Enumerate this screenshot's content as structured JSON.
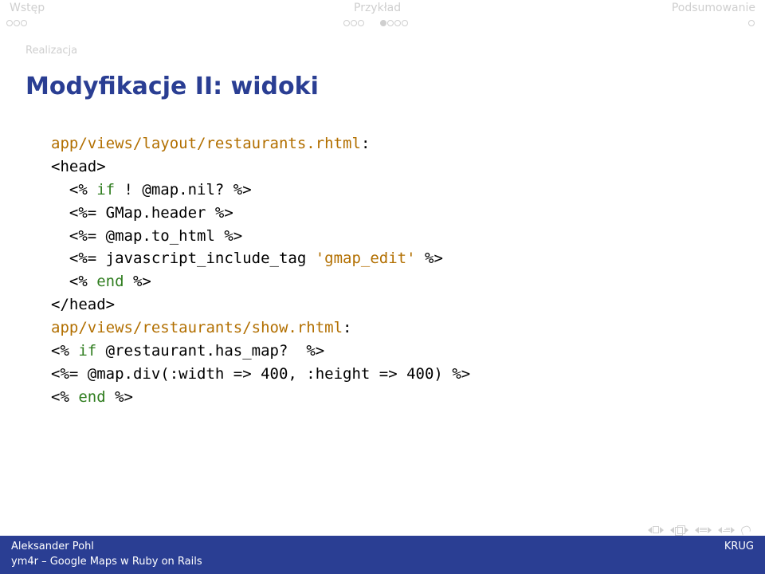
{
  "nav": {
    "left": "Wstęp",
    "center": "Przykład",
    "right": "Podsumowanie"
  },
  "section": "Realizacja",
  "title": "Modyfikacje II: widoki",
  "code": {
    "l1a": "app/views/layout/restaurants.rhtml",
    "l1b": ":",
    "l2": "<head>",
    "l3a": "  <% ",
    "l3b": "if",
    "l3c": " ! @map.nil? %>",
    "l4": "  <%= GMap.header %>",
    "l5": "  <%= @map.to_html %>",
    "l6a": "  <%= javascript_include_tag ",
    "l6b": "'gmap_edit'",
    "l6c": " %>",
    "l7a": "  <% ",
    "l7b": "end",
    "l7c": " %>",
    "l8": "</head>",
    "l9a": "app/views/restaurants/show.rhtml",
    "l9b": ":",
    "l10a": "<% ",
    "l10b": "if",
    "l10c": " @restaurant.has_map?  %>",
    "l11": "<%= @map.div(:width => 400, :height => 400) %>",
    "l12a": "<% ",
    "l12b": "end",
    "l12c": " %>"
  },
  "footer": {
    "author": "Aleksander Pohl",
    "org": "KRUG",
    "talk": "ym4r – Google Maps w Ruby on Rails"
  }
}
